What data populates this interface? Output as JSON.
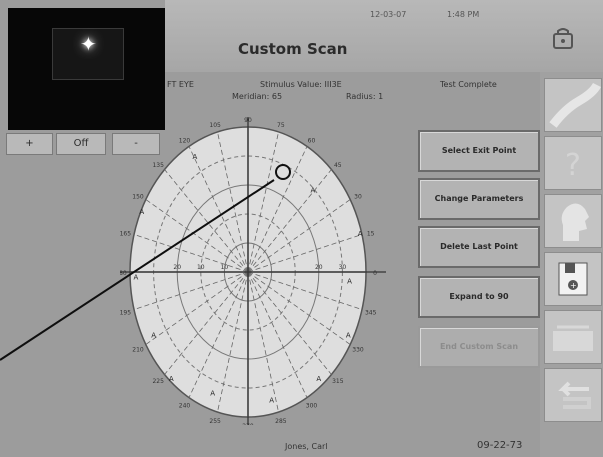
{
  "header": {
    "title": "Custom Scan",
    "date": "12-03-07",
    "time": "1:48 PM"
  },
  "camera": {
    "buttons": [
      {
        "label": "+"
      },
      {
        "label": "Off"
      },
      {
        "label": "-"
      }
    ]
  },
  "info": {
    "eye": "FT EYE",
    "stimulus": "Stimulus Value: III3E",
    "meridian": "Meridian: 65",
    "radius": "Radius: 1",
    "status": "Test Complete"
  },
  "plot": {
    "angle_labels": [
      "0",
      "15",
      "30",
      "45",
      "60",
      "75",
      "90",
      "105",
      "120",
      "135",
      "150",
      "165",
      "180",
      "195",
      "210",
      "225",
      "240",
      "255",
      "270",
      "285",
      "300",
      "315",
      "330",
      "345"
    ],
    "ring_labels": [
      "10",
      "20",
      "30",
      "10",
      "20"
    ],
    "marker": "A"
  },
  "actions": [
    {
      "label": "Select Exit Point",
      "enabled": true
    },
    {
      "label": "Change Parameters",
      "enabled": true
    },
    {
      "label": "Delete Last Point",
      "enabled": true
    },
    {
      "label": "Expand to 90",
      "enabled": true
    },
    {
      "label": "End Custom Scan",
      "enabled": false
    }
  ],
  "footer": {
    "patient_name": "Jones, Carl",
    "dob": "09-22-73"
  }
}
